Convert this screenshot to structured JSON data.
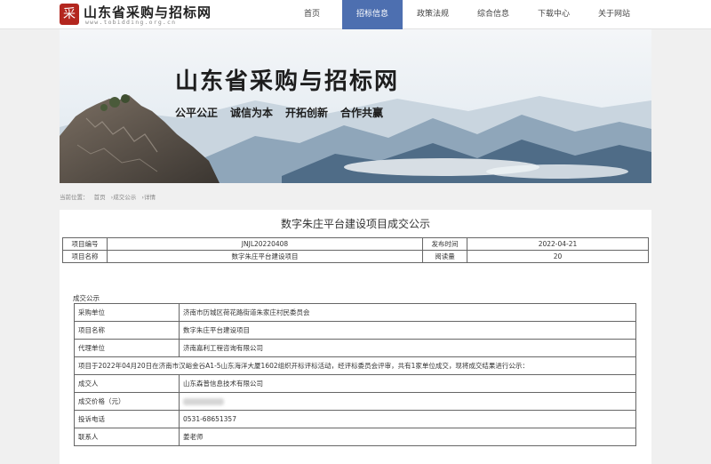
{
  "header": {
    "logo_mark": "采",
    "site_title": "山东省采购与招标网",
    "site_url": "www.tobidding.org.cn",
    "nav": [
      {
        "label": "首页",
        "active": false
      },
      {
        "label": "招标信息",
        "active": true
      },
      {
        "label": "政策法规",
        "active": false
      },
      {
        "label": "综合信息",
        "active": false
      },
      {
        "label": "下载中心",
        "active": false
      },
      {
        "label": "关于网站",
        "active": false
      }
    ]
  },
  "banner": {
    "title": "山东省采购与招标网",
    "slogans": [
      "公平公正",
      "诚信为本",
      "开拓创新",
      "合作共赢"
    ]
  },
  "breadcrumb": {
    "prefix": "当前位置：",
    "items": [
      "首页",
      "›成交公示",
      "›详情"
    ]
  },
  "notice": {
    "title": "数字朱庄平台建设项目成交公示",
    "info": {
      "code_label": "项目编号",
      "code_value": "JNJL20220408",
      "date_label": "发布时间",
      "date_value": "2022-04-21",
      "name_label": "项目名称",
      "name_value": "数字朱庄平台建设项目",
      "reads_label": "阅读量",
      "reads_value": "20"
    },
    "section_label": "成交公示",
    "rows": [
      {
        "label": "采购单位",
        "value": "济南市历城区荷花路街道朱家庄村民委员会"
      },
      {
        "label": "项目名称",
        "value": "数字朱庄平台建设项目"
      },
      {
        "label": "代理单位",
        "value": "济南嘉利工程咨询有限公司"
      }
    ],
    "statement": "项目于2022年04月20日在济南市汉峪金谷A1-5山东海洋大厦1602组织开标评标活动，经评标委员会评审，共有1家单位成交，现将成交结果进行公示：",
    "result_rows": [
      {
        "label": "成交人",
        "value": "山东森普信息技术有限公司"
      },
      {
        "label": "成交价格（元）",
        "value": ""
      },
      {
        "label": "投诉电话",
        "value": "0531-68651357"
      },
      {
        "label": "联系人",
        "value": "姜老师"
      }
    ]
  }
}
